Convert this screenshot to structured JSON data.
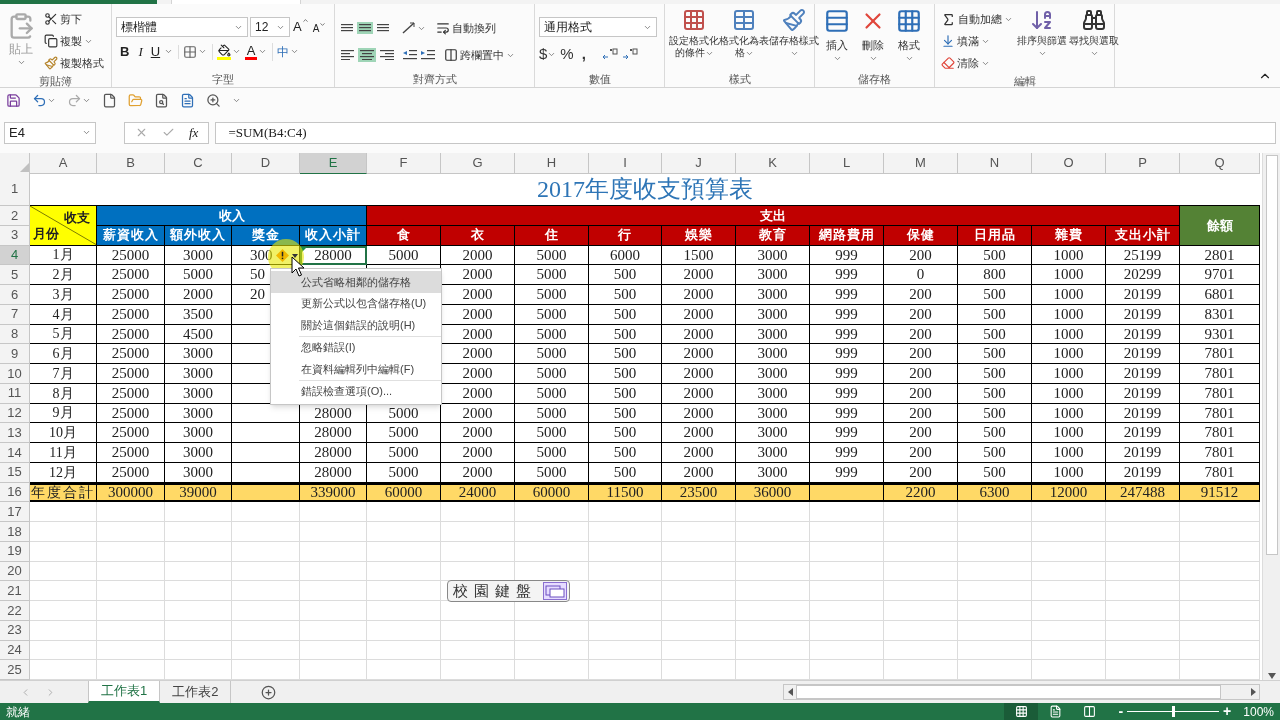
{
  "ribbon": {
    "groups": [
      {
        "kind": "clipboard",
        "label": "剪貼簿",
        "paste": "貼上",
        "items": [
          "剪下",
          "複製",
          "複製格式"
        ]
      },
      {
        "kind": "font",
        "label": "字型",
        "font": "標楷體",
        "size": "12",
        "grow": "A",
        "shrink": "A",
        "styles": [
          "B",
          "I",
          "U"
        ],
        "color_letter": "A",
        "phonetic": "中"
      },
      {
        "kind": "alignment",
        "label": "對齊方式",
        "vertical": [
          {
            "selected": false
          },
          {
            "selected": true
          },
          {
            "selected": false
          }
        ],
        "horizontal": [
          {
            "selected": false
          },
          {
            "selected": true
          },
          {
            "selected": false
          }
        ],
        "wrap": "自動換列",
        "merge": "跨欄置中"
      },
      {
        "kind": "number",
        "label": "數值",
        "format": "通用格式",
        "symbols": [
          "$",
          "%",
          ","
        ]
      },
      {
        "kind": "styles",
        "label": "樣式",
        "buttons": [
          "設定格式化的條件",
          "格式化為表格",
          "儲存格樣式"
        ]
      },
      {
        "kind": "cells",
        "label": "儲存格",
        "buttons": [
          "插入",
          "刪除",
          "格式"
        ]
      },
      {
        "kind": "editing",
        "label": "編輯",
        "items": [
          "自動加總",
          "填滿",
          "清除"
        ],
        "buttons": [
          "排序與篩選",
          "尋找與選取"
        ]
      }
    ]
  },
  "formula_bar": {
    "name_box": "E4",
    "fx": "fx",
    "formula": "=SUM(B4:C4)"
  },
  "columns": [
    {
      "label": "A",
      "selected": false
    },
    {
      "label": "B",
      "selected": false
    },
    {
      "label": "C",
      "selected": false
    },
    {
      "label": "D",
      "selected": false
    },
    {
      "label": "E",
      "selected": true
    },
    {
      "label": "F",
      "selected": false
    },
    {
      "label": "G",
      "selected": false
    },
    {
      "label": "H",
      "selected": false
    },
    {
      "label": "I",
      "selected": false
    },
    {
      "label": "J",
      "selected": false
    },
    {
      "label": "K",
      "selected": false
    },
    {
      "label": "L",
      "selected": false
    },
    {
      "label": "M",
      "selected": false
    },
    {
      "label": "N",
      "selected": false
    },
    {
      "label": "O",
      "selected": false
    },
    {
      "label": "P",
      "selected": false
    },
    {
      "label": "Q",
      "selected": false
    }
  ],
  "row_headers": [
    {
      "label": "1",
      "selected": false
    },
    {
      "label": "2",
      "selected": false
    },
    {
      "label": "3",
      "selected": false
    },
    {
      "label": "4",
      "selected": true
    },
    {
      "label": "5",
      "selected": false
    },
    {
      "label": "6",
      "selected": false
    },
    {
      "label": "7",
      "selected": false
    },
    {
      "label": "8",
      "selected": false
    },
    {
      "label": "9",
      "selected": false
    },
    {
      "label": "10",
      "selected": false
    },
    {
      "label": "11",
      "selected": false
    },
    {
      "label": "12",
      "selected": false
    },
    {
      "label": "13",
      "selected": false
    },
    {
      "label": "14",
      "selected": false
    },
    {
      "label": "15",
      "selected": false
    },
    {
      "label": "16",
      "selected": false
    },
    {
      "label": "17",
      "selected": false
    },
    {
      "label": "18",
      "selected": false
    },
    {
      "label": "19",
      "selected": false
    },
    {
      "label": "20",
      "selected": false
    },
    {
      "label": "21",
      "selected": false
    },
    {
      "label": "22",
      "selected": false
    },
    {
      "label": "23",
      "selected": false
    },
    {
      "label": "24",
      "selected": false
    },
    {
      "label": "25",
      "selected": false
    }
  ],
  "sheet": {
    "title": "2017年度收支預算表",
    "corner": {
      "top": "收支",
      "bottom": "月份",
      "color": "#ffff00"
    },
    "bands": [
      {
        "label": "收入",
        "color": "#0070c0",
        "columns": [
          "薪資收入",
          "額外收入",
          "獎金",
          "收入小計"
        ]
      },
      {
        "label": "支出",
        "color": "#c00000",
        "columns": [
          "食",
          "衣",
          "住",
          "行",
          "娛樂",
          "教育",
          "網路費用",
          "保健",
          "日用品",
          "雜費",
          "支出小計"
        ]
      }
    ],
    "balance": {
      "label": "餘額",
      "color": "#548235"
    },
    "rows": [
      {
        "month": "1月",
        "flagged": true,
        "cells": [
          "25000",
          "3000",
          "300",
          "28000",
          "5000",
          "2000",
          "5000",
          "6000",
          "1500",
          "3000",
          "999",
          "200",
          "500",
          "1000",
          "25199",
          "2801"
        ]
      },
      {
        "month": "2月",
        "cells": [
          "25000",
          "5000",
          "50",
          null,
          null,
          "2000",
          "5000",
          "500",
          "2000",
          "3000",
          "999",
          "0",
          "800",
          "1000",
          "20299",
          "9701"
        ]
      },
      {
        "month": "3月",
        "cells": [
          "25000",
          "2000",
          "20",
          null,
          null,
          "2000",
          "5000",
          "500",
          "2000",
          "3000",
          "999",
          "200",
          "500",
          "1000",
          "20199",
          "6801"
        ]
      },
      {
        "month": "4月",
        "cells": [
          "25000",
          "3500",
          null,
          null,
          null,
          "2000",
          "5000",
          "500",
          "2000",
          "3000",
          "999",
          "200",
          "500",
          "1000",
          "20199",
          "8301"
        ]
      },
      {
        "month": "5月",
        "cells": [
          "25000",
          "4500",
          null,
          null,
          null,
          "2000",
          "5000",
          "500",
          "2000",
          "3000",
          "999",
          "200",
          "500",
          "1000",
          "20199",
          "9301"
        ]
      },
      {
        "month": "6月",
        "cells": [
          "25000",
          "3000",
          null,
          null,
          null,
          "2000",
          "5000",
          "500",
          "2000",
          "3000",
          "999",
          "200",
          "500",
          "1000",
          "20199",
          "7801"
        ]
      },
      {
        "month": "7月",
        "cells": [
          "25000",
          "3000",
          null,
          null,
          null,
          "2000",
          "5000",
          "500",
          "2000",
          "3000",
          "999",
          "200",
          "500",
          "1000",
          "20199",
          "7801"
        ]
      },
      {
        "month": "8月",
        "cells": [
          "25000",
          "3000",
          null,
          null,
          null,
          "2000",
          "5000",
          "500",
          "2000",
          "3000",
          "999",
          "200",
          "500",
          "1000",
          "20199",
          "7801"
        ]
      },
      {
        "month": "9月",
        "flagged": false,
        "cells": [
          "25000",
          "3000",
          null,
          "28000",
          "5000",
          "2000",
          "5000",
          "500",
          "2000",
          "3000",
          "999",
          "200",
          "500",
          "1000",
          "20199",
          "7801"
        ]
      },
      {
        "month": "10月",
        "flagged": false,
        "cells": [
          "25000",
          "3000",
          null,
          "28000",
          "5000",
          "2000",
          "5000",
          "500",
          "2000",
          "3000",
          "999",
          "200",
          "500",
          "1000",
          "20199",
          "7801"
        ]
      },
      {
        "month": "11月",
        "flagged": false,
        "cells": [
          "25000",
          "3000",
          null,
          "28000",
          "5000",
          "2000",
          "5000",
          "500",
          "2000",
          "3000",
          "999",
          "200",
          "500",
          "1000",
          "20199",
          "7801"
        ]
      },
      {
        "month": "12月",
        "flagged": false,
        "cells": [
          "25000",
          "3000",
          null,
          "28000",
          "5000",
          "2000",
          "5000",
          "500",
          "2000",
          "3000",
          "999",
          "200",
          "500",
          "1000",
          "20199",
          "7801"
        ]
      }
    ],
    "total": {
      "label": "年度合計",
      "cells": [
        "300000",
        "39000",
        null,
        "339000",
        "60000",
        "24000",
        "60000",
        "11500",
        "23500",
        "36000",
        null,
        "2200",
        "6300",
        "12000",
        "247488",
        "91512"
      ]
    }
  },
  "error_menu": {
    "groups": [
      [
        {
          "label": "公式省略相鄰的儲存格",
          "selected": true
        },
        {
          "label": "更新公式以包含儲存格(U)",
          "selected": false
        },
        {
          "label": "關於這個錯誤的說明(H)",
          "selected": false
        }
      ],
      [
        {
          "label": "忽略錯誤(I)",
          "selected": false
        },
        {
          "label": "在資料編輯列中編輯(F)",
          "selected": false
        }
      ],
      [
        {
          "label": "錯誤檢查選項(O)...",
          "selected": false
        }
      ]
    ]
  },
  "ime_bar": {
    "label": "校園鍵盤"
  },
  "sheet_tabs": [
    {
      "label": "工作表1",
      "selected": true
    },
    {
      "label": "工作表2",
      "selected": false
    }
  ],
  "status_bar": {
    "text": "就緒",
    "views": [
      {
        "kind": "normal",
        "selected": true
      },
      {
        "kind": "page_layout",
        "selected": false
      },
      {
        "kind": "page_break",
        "selected": false
      }
    ],
    "zoom_out": "-",
    "zoom_in": "+",
    "zoom": {
      "level": 0.5
    },
    "zoom_text": "100%"
  }
}
